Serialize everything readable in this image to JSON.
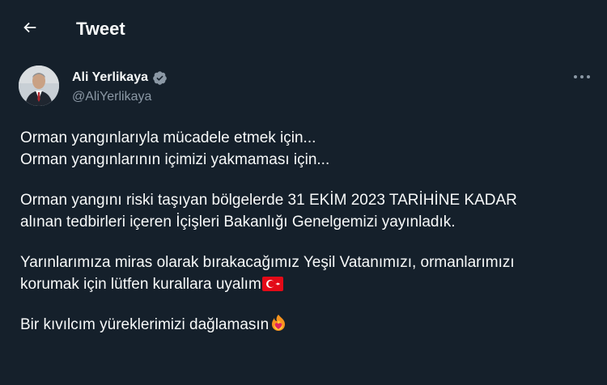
{
  "header": {
    "title": "Tweet",
    "back_icon": "arrow-left-icon"
  },
  "author": {
    "display_name": "Ali Yerlikaya",
    "handle": "@AliYerlikaya",
    "verified_icon": "verified-badge-icon"
  },
  "more_icon": "more-horizontal-icon",
  "tweet": {
    "lines": [
      "Orman yangınlarıyla mücadele etmek için...",
      "Orman yangınlarının içimizi yakmaması için...",
      "Orman yangını riski taşıyan bölgelerde 31 EKİM 2023 TARİHİNE KADAR",
      "alınan tedbirleri içeren İçişleri Bakanlığı Genelgemizi yayınladık.",
      "Yarınlarımıza miras olarak bırakacağımız Yeşil Vatanımızı, ormanlarımızı",
      "korumak için lütfen kurallara uyalım",
      "Bir kıvılcım yüreklerimizi dağlamasın"
    ],
    "emoji_flag": "turkey-flag-emoji",
    "emoji_fire_heart": "heart-on-fire-emoji"
  },
  "colors": {
    "background": "#15202b",
    "text": "#f7f9f9",
    "secondary_text": "#8b98a5",
    "verified": "#1d9bf0",
    "flag_red": "#e30a17"
  }
}
